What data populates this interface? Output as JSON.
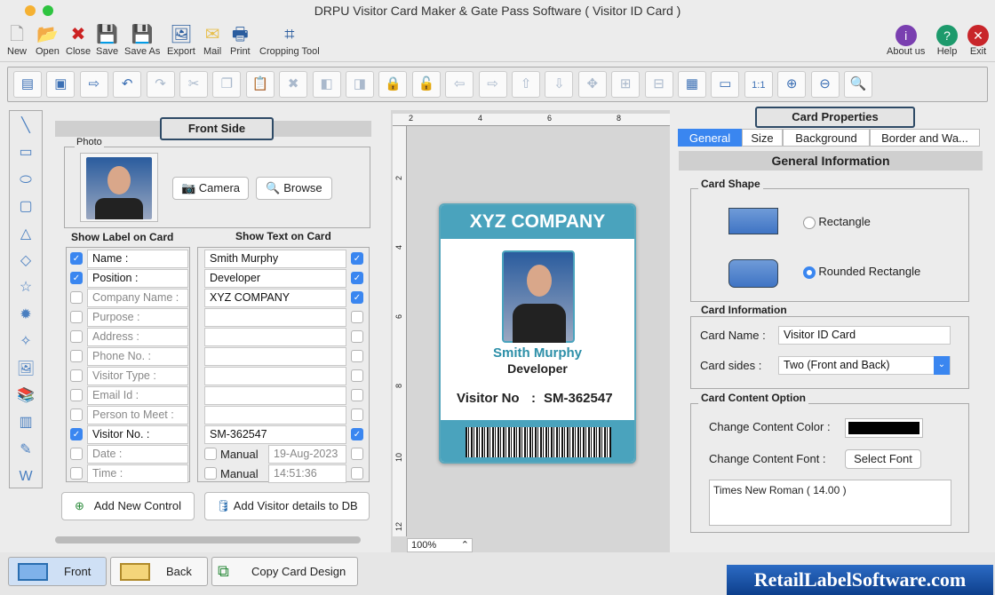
{
  "window": {
    "title": "DRPU Visitor Card Maker & Gate Pass Software ( Visitor ID Card )"
  },
  "menu": {
    "items": [
      {
        "label": "New",
        "icon": "new-file-icon"
      },
      {
        "label": "Open",
        "icon": "open-folder-icon"
      },
      {
        "label": "Close",
        "icon": "close-file-icon"
      },
      {
        "label": "Save",
        "icon": "save-icon"
      },
      {
        "label": "Save As",
        "icon": "save-as-icon"
      },
      {
        "label": "Export",
        "icon": "export-icon"
      },
      {
        "label": "Mail",
        "icon": "mail-icon"
      },
      {
        "label": "Print",
        "icon": "print-icon"
      },
      {
        "label": "Cropping Tool",
        "icon": "crop-icon"
      }
    ],
    "right": [
      {
        "label": "About us",
        "icon": "about-icon"
      },
      {
        "label": "Help",
        "icon": "help-icon"
      },
      {
        "label": "Exit",
        "icon": "exit-icon"
      }
    ]
  },
  "front": {
    "title": "Front Side",
    "photo_label": "Photo",
    "camera": "Camera",
    "browse": "Browse",
    "label_header": "Show Label on Card",
    "text_header": "Show Text on Card",
    "rows": [
      {
        "label": "Name :",
        "label_on": true,
        "text": "Smith Murphy",
        "text_on": true
      },
      {
        "label": "Position :",
        "label_on": true,
        "text": "Developer",
        "text_on": true
      },
      {
        "label": "Company Name :",
        "label_on": false,
        "text": "XYZ COMPANY",
        "text_on": true
      },
      {
        "label": "Purpose :",
        "label_on": false,
        "text": "",
        "text_on": false
      },
      {
        "label": "Address :",
        "label_on": false,
        "text": "",
        "text_on": false
      },
      {
        "label": "Phone No. :",
        "label_on": false,
        "text": "",
        "text_on": false
      },
      {
        "label": "Visitor Type :",
        "label_on": false,
        "text": "",
        "text_on": false
      },
      {
        "label": "Email Id :",
        "label_on": false,
        "text": "",
        "text_on": false
      },
      {
        "label": "Person to Meet :",
        "label_on": false,
        "text": "",
        "text_on": false
      },
      {
        "label": "Visitor No. :",
        "label_on": true,
        "text": "SM-362547",
        "text_on": true
      },
      {
        "label": "Date :",
        "label_on": false,
        "manual": "Manual",
        "text": "19-Aug-2023",
        "text_on": false
      },
      {
        "label": "Time :",
        "label_on": false,
        "manual": "Manual",
        "text": "14:51:36",
        "text_on": false
      }
    ],
    "add_control": "Add New Control",
    "add_db": "Add Visitor details to DB"
  },
  "canvas": {
    "zoom": "100%",
    "ruler_top": [
      "2",
      "4",
      "6",
      "8"
    ],
    "ruler_left": [
      "2",
      "4",
      "6",
      "8",
      "10",
      "12"
    ]
  },
  "card": {
    "company": "XYZ COMPANY",
    "name": "Smith Murphy",
    "position": "Developer",
    "visitor_label": "Visitor No",
    "visitor_sep": ":",
    "visitor_no": "SM-362547",
    "header_color": "#4aa3bd",
    "name_color": "#2c8fa8"
  },
  "props": {
    "title": "Card Properties",
    "tabs": [
      "General",
      "Size",
      "Background",
      "Border and Wa..."
    ],
    "section": "General Information",
    "shape_title": "Card Shape",
    "shape_opts": [
      "Rectangle",
      "Rounded Rectangle"
    ],
    "shape_selected": "Rounded Rectangle",
    "info_title": "Card Information",
    "card_name_label": "Card Name :",
    "card_name": "Visitor ID Card",
    "sides_label": "Card sides :",
    "sides": "Two (Front and Back)",
    "content_title": "Card Content Option",
    "color_label": "Change Content Color :",
    "content_color": "#000000",
    "font_label": "Change Content Font :",
    "select_font": "Select Font",
    "font_value": "Times New Roman ( 14.00 )"
  },
  "bottom": {
    "front": "Front",
    "back": "Back",
    "copy": "Copy Card Design",
    "brand": "RetailLabelSoftware.com"
  }
}
